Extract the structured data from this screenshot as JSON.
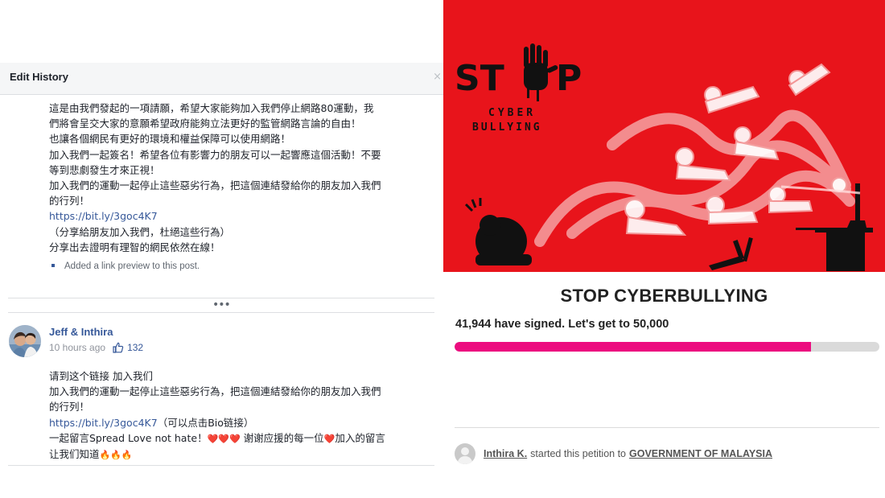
{
  "edit_history": {
    "title": "Edit History",
    "close_glyph": "×",
    "first_version": {
      "lines": [
        "這是由我們發起的一項請願，希望大家能夠加入我們停止網路80運動，我",
        "們將會呈交大家的意願希望政府能夠立法更好的監管網路言論的自由！",
        "也讓各個網民有更好的環境和權益保障可以使用網路！",
        "加入我們一起簽名！希望各位有影響力的朋友可以一起響應這個活動！不要",
        "等到悲劇發生才來正視！",
        "加入我們的運動一起停止這些惡劣行為，把這個連結發給你的朋友加入我們",
        "的行列！"
      ],
      "link": "https://bit.ly/3goc4K7",
      "after_link": [
        "（分享給朋友加入我們，杜絕這些行為）",
        "分享出去證明有理智的網民依然在線！"
      ],
      "note": "Added a link preview to this post."
    },
    "more_glyph": "•••",
    "second_version": {
      "author": "Jeff & Inthira",
      "time": "10 hours ago",
      "likes": "132",
      "line1": "请到这个链接 加入我们",
      "line2": "加入我們的運動一起停止這些惡劣行為，把這個連結發給你的朋友加入我們",
      "line3": "的行列！",
      "link": "https://bit.ly/3goc4K7",
      "link_suffix": "（可以点击Bio链接）",
      "line5_prefix": "一起留言Spread Love not hate！",
      "line5_hearts": "❤️❤️❤️",
      "line5_mid": "谢谢应援的每一位",
      "line5_heart": "❤️",
      "line5_suffix": "加入的留言",
      "line6_prefix": "让我们知道",
      "line6_fires": "🔥🔥🔥"
    }
  },
  "petition": {
    "banner": {
      "stop_text": "ST",
      "stop_text_end": "P",
      "cyber_text": "CYBER",
      "bullying_text": "BULLYING",
      "bg_color": "#e8141b"
    },
    "title": "STOP CYBERBULLYING",
    "signed_text": "41,944 have signed. Let's get to 50,000",
    "progress_fraction": 0.839,
    "progress_color": "#ec0c7f",
    "starter_name": "Inthira K.",
    "starter_mid": "started this petition to",
    "target": "GOVERNMENT OF MALAYSIA"
  }
}
